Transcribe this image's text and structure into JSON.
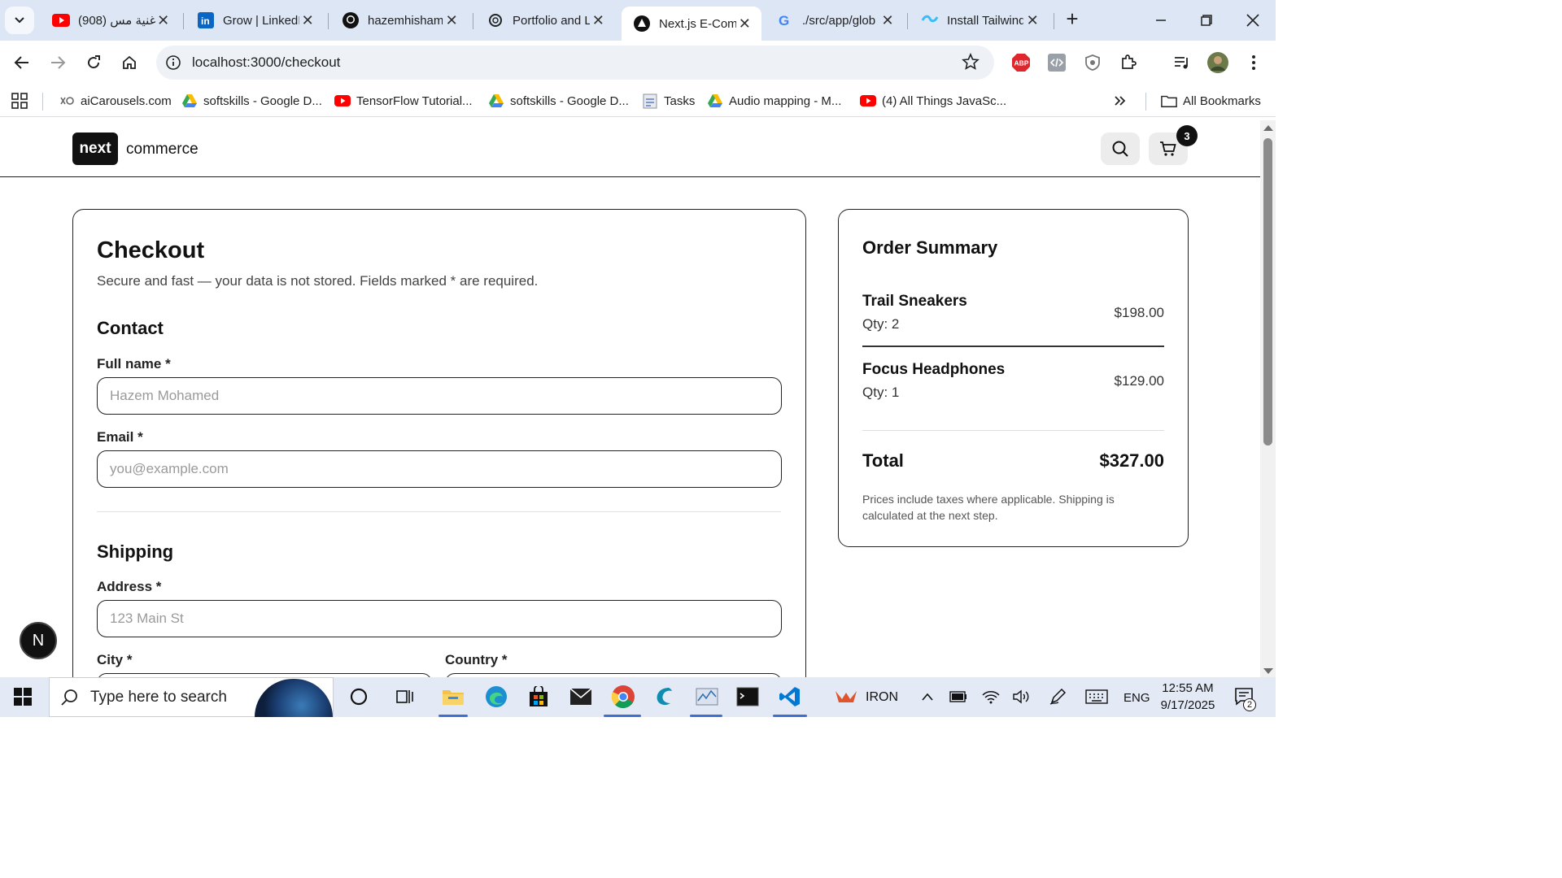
{
  "browser": {
    "tabs": [
      {
        "title": "(908) اغنية مس...",
        "icon": "youtube-icon"
      },
      {
        "title": "Grow | LinkedIn",
        "icon": "linkedin-icon"
      },
      {
        "title": "hazemhisham",
        "icon": "github-icon"
      },
      {
        "title": "Portfolio and L",
        "icon": "openai-icon"
      },
      {
        "title": "Next.js E-Com",
        "icon": "nextjs-icon",
        "active": true
      },
      {
        "title": "./src/app/glob",
        "icon": "google-icon"
      },
      {
        "title": "Install Tailwind",
        "icon": "tailwind-icon"
      }
    ],
    "url": "localhost:3000/checkout",
    "bookmarks": [
      {
        "label": "aiCarousels.com",
        "icon": "aicarousels-icon"
      },
      {
        "label": "softskills - Google D...",
        "icon": "google-drive-icon"
      },
      {
        "label": "TensorFlow Tutorial...",
        "icon": "youtube-icon"
      },
      {
        "label": "softskills - Google D...",
        "icon": "google-drive-icon"
      },
      {
        "label": "Tasks",
        "icon": "tasks-icon"
      },
      {
        "label": "Audio mapping - M...",
        "icon": "google-drive-icon"
      },
      {
        "label": "(4) All Things JavaSc...",
        "icon": "youtube-icon"
      }
    ],
    "all_bookmarks": "All Bookmarks",
    "extension_abp": "ABP"
  },
  "site": {
    "logo_box": "next",
    "logo_text": "commerce",
    "cart_count": "3"
  },
  "checkout": {
    "title": "Checkout",
    "subtitle": "Secure and fast — your data is not stored. Fields marked * are required.",
    "contact_heading": "Contact",
    "fullname_label": "Full name *",
    "fullname_placeholder": "Hazem Mohamed",
    "email_label": "Email *",
    "email_placeholder": "you@example.com",
    "shipping_heading": "Shipping",
    "address_label": "Address *",
    "address_placeholder": "123 Main St",
    "city_label": "City *",
    "country_label": "Country *"
  },
  "summary": {
    "title": "Order Summary",
    "items": [
      {
        "name": "Trail Sneakers",
        "qty": "Qty: 2",
        "price": "$198.00"
      },
      {
        "name": "Focus Headphones",
        "qty": "Qty: 1",
        "price": "$129.00"
      }
    ],
    "total_label": "Total",
    "total_value": "$327.00",
    "note": "Prices include taxes where applicable. Shipping is calculated at the next step."
  },
  "dev_overlay": "N",
  "taskbar": {
    "search_placeholder": "Type here to search",
    "iron_label": "IRON",
    "language": "ENG",
    "time": "12:55 AM",
    "date": "9/17/2025",
    "notification_count": "2"
  }
}
